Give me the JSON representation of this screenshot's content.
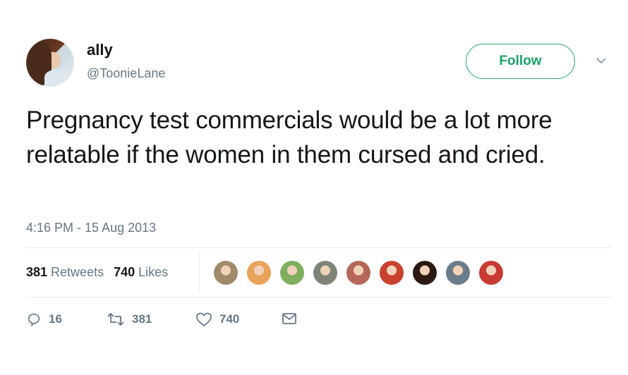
{
  "user": {
    "name": "ally",
    "handle": "@ToonieLane"
  },
  "follow_label": "Follow",
  "tweet": {
    "text": "Pregnancy test commercials would be a lot more relatable if the women in them cursed and cried.",
    "timestamp": "4:16 PM - 15 Aug 2013"
  },
  "stats": {
    "retweets_count": "381",
    "retweets_label": "Retweets",
    "likes_count": "740",
    "likes_label": "Likes"
  },
  "liker_avatars": [
    {
      "name": "liker-avatar-1",
      "color": "#a08a6a"
    },
    {
      "name": "liker-avatar-2",
      "color": "#e8a25a"
    },
    {
      "name": "liker-avatar-3",
      "color": "#7fae5e"
    },
    {
      "name": "liker-avatar-4",
      "color": "#7d8377"
    },
    {
      "name": "liker-avatar-5",
      "color": "#b5675a"
    },
    {
      "name": "liker-avatar-6",
      "color": "#c9412f"
    },
    {
      "name": "liker-avatar-7",
      "color": "#2b1a12"
    },
    {
      "name": "liker-avatar-8",
      "color": "#6b7c8c"
    },
    {
      "name": "liker-avatar-9",
      "color": "#c73b34"
    }
  ],
  "actions": {
    "replies": "16",
    "retweets": "381",
    "likes": "740"
  },
  "colors": {
    "follow_green": "#1da06a",
    "text_primary": "#14171a",
    "text_secondary": "#657786",
    "divider": "#e6ecf0"
  },
  "icons": [
    "reply-icon",
    "retweet-icon",
    "like-icon",
    "direct-message-icon",
    "chevron-down-icon"
  ]
}
